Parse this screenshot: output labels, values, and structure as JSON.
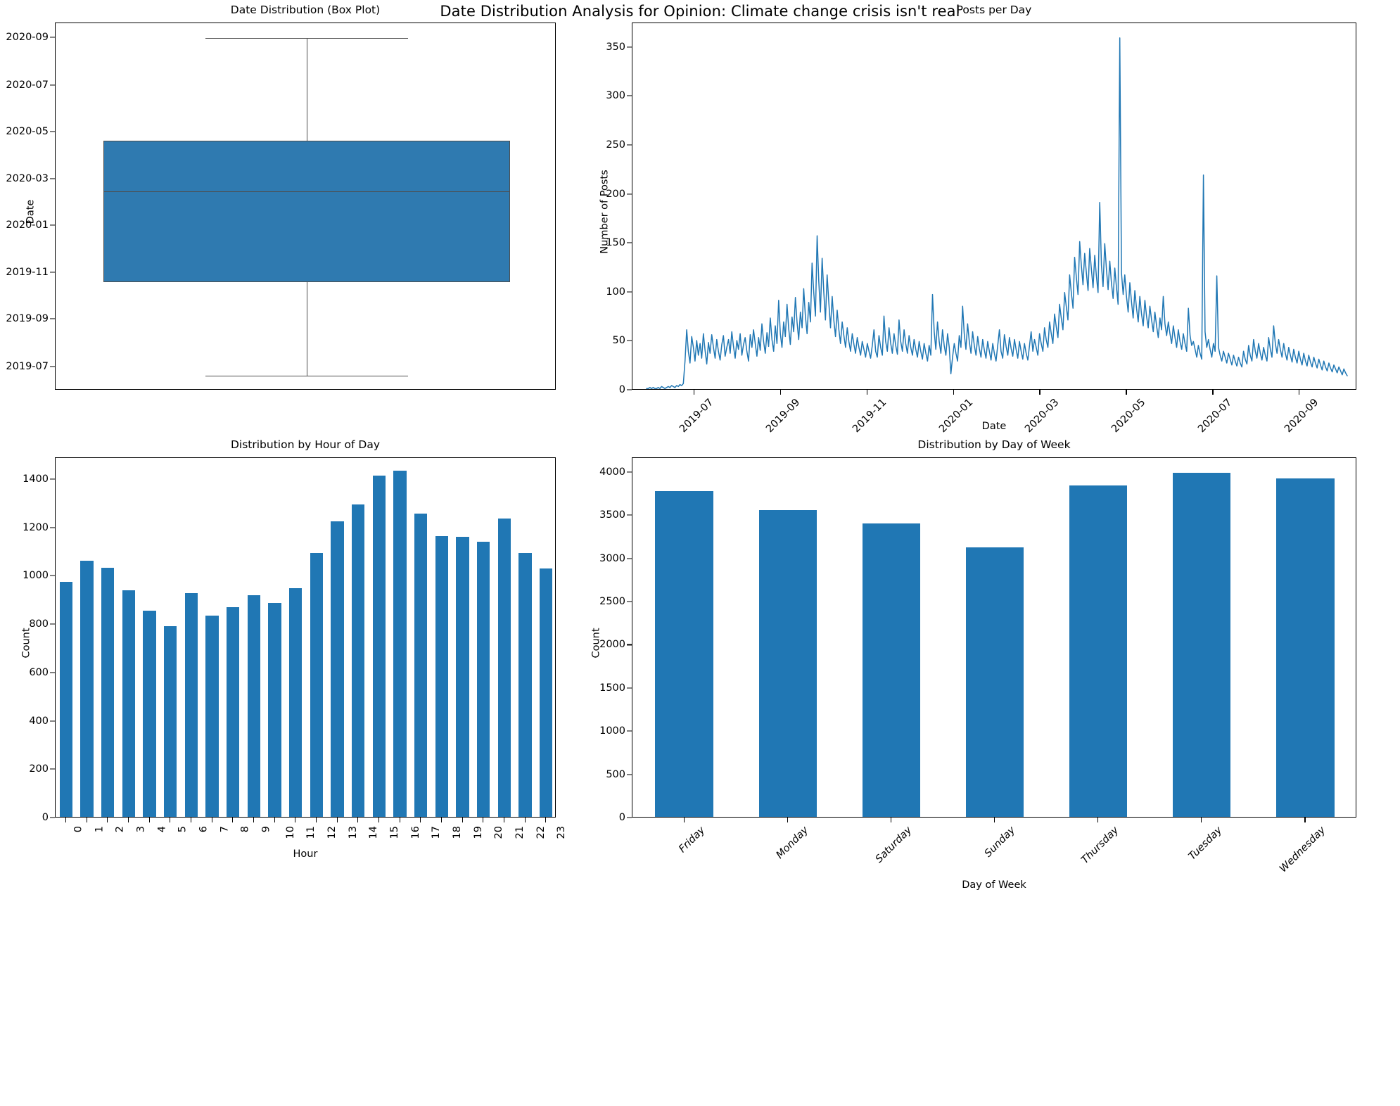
{
  "figure": {
    "title": "Date Distribution Analysis for Opinion: Climate change crisis isn't real",
    "accent_color": "#2077b4",
    "box_fill_color": "#2f7ab0",
    "line_color": "#4d4d4d"
  },
  "chart_data": [
    {
      "type": "box",
      "title": "Date Distribution (Box Plot)",
      "xlabel": "",
      "ylabel": "Date",
      "ytick_labels": [
        "2020-09",
        "2020-07",
        "2020-05",
        "2020-03",
        "2020-01",
        "2019-11",
        "2019-09",
        "2019-07"
      ],
      "ylim": [
        "2019-06-01",
        "2020-09-20"
      ],
      "grid": false,
      "box": {
        "whisker_high": "2020-09-01",
        "q3": "2020-04-20",
        "median": "2020-02-15",
        "q1": "2019-10-20",
        "whisker_low": "2019-06-20"
      }
    },
    {
      "type": "line",
      "title": "Posts per Day",
      "xlabel": "Date",
      "ylabel": "Number of Posts",
      "xtick_labels": [
        "2019-07",
        "2019-09",
        "2019-11",
        "2020-01",
        "2020-03",
        "2020-05",
        "2020-07",
        "2020-09"
      ],
      "ytick_labels": [
        "0",
        "50",
        "100",
        "150",
        "200",
        "250",
        "300",
        "350"
      ],
      "ylim": [
        0,
        375
      ],
      "grid": false,
      "peak_value": 360,
      "peak_date": "2020-04-20",
      "secondary_peak_value": 220,
      "secondary_peak_date": "2020-06-01",
      "values": [
        2,
        2,
        3,
        2,
        3,
        2,
        2,
        3,
        2,
        4,
        3,
        2,
        3,
        4,
        3,
        5,
        4,
        3,
        5,
        4,
        6,
        5,
        7,
        30,
        62,
        40,
        28,
        55,
        44,
        30,
        51,
        36,
        48,
        33,
        58,
        41,
        27,
        49,
        38,
        57,
        44,
        33,
        52,
        40,
        31,
        47,
        56,
        35,
        44,
        52,
        38,
        60,
        45,
        33,
        51,
        42,
        58,
        36,
        47,
        54,
        40,
        30,
        57,
        44,
        62,
        48,
        35,
        54,
        41,
        68,
        50,
        38,
        59,
        45,
        74,
        52,
        40,
        66,
        48,
        92,
        58,
        44,
        70,
        55,
        88,
        63,
        47,
        75,
        60,
        95,
        70,
        52,
        80,
        64,
        104,
        76,
        58,
        90,
        70,
        130,
        100,
        76,
        158,
        112,
        80,
        135,
        100,
        72,
        118,
        90,
        64,
        96,
        72,
        55,
        82,
        62,
        48,
        70,
        56,
        44,
        64,
        50,
        40,
        58,
        47,
        38,
        54,
        44,
        36,
        50,
        42,
        34,
        48,
        40,
        33,
        46,
        62,
        40,
        34,
        56,
        44,
        36,
        76,
        50,
        40,
        64,
        48,
        38,
        58,
        46,
        37,
        72,
        50,
        40,
        62,
        48,
        38,
        56,
        44,
        36,
        52,
        42,
        34,
        50,
        40,
        32,
        48,
        38,
        30,
        46,
        36,
        98,
        60,
        42,
        70,
        50,
        38,
        62,
        46,
        36,
        58,
        44,
        17,
        34,
        48,
        38,
        30,
        56,
        44,
        86,
        58,
        42,
        68,
        50,
        38,
        60,
        46,
        36,
        55,
        43,
        34,
        52,
        41,
        33,
        50,
        40,
        31,
        48,
        38,
        30,
        46,
        62,
        40,
        33,
        57,
        45,
        36,
        54,
        43,
        35,
        52,
        42,
        33,
        50,
        40,
        32,
        48,
        38,
        31,
        46,
        60,
        40,
        52,
        44,
        36,
        58,
        48,
        40,
        64,
        52,
        44,
        70,
        58,
        48,
        78,
        65,
        54,
        88,
        74,
        62,
        100,
        86,
        72,
        118,
        100,
        84,
        136,
        116,
        98,
        152,
        128,
        108,
        140,
        120,
        102,
        145,
        124,
        105,
        138,
        117,
        100,
        192,
        128,
        106,
        150,
        124,
        103,
        132,
        110,
        94,
        125,
        105,
        88,
        360,
        120,
        98,
        118,
        96,
        80,
        110,
        90,
        74,
        102,
        84,
        70,
        96,
        78,
        66,
        92,
        76,
        64,
        86,
        72,
        60,
        80,
        66,
        54,
        74,
        62,
        96,
        68,
        56,
        70,
        58,
        48,
        66,
        54,
        44,
        62,
        50,
        42,
        58,
        48,
        40,
        84,
        56,
        46,
        50,
        42,
        34,
        46,
        38,
        32,
        220,
        60,
        44,
        52,
        42,
        34,
        48,
        40,
        117,
        44,
        36,
        30,
        40,
        34,
        28,
        38,
        32,
        26,
        36,
        30,
        25,
        34,
        28,
        24,
        40,
        32,
        27,
        46,
        36,
        30,
        52,
        40,
        33,
        48,
        38,
        31,
        44,
        36,
        30,
        54,
        42,
        34,
        66,
        48,
        38,
        52,
        42,
        34,
        48,
        38,
        31,
        44,
        36,
        29,
        42,
        34,
        28,
        40,
        32,
        26,
        38,
        30,
        25,
        36,
        29,
        24,
        34,
        28,
        23,
        32,
        26,
        21,
        30,
        24,
        20,
        28,
        23,
        19,
        26,
        22,
        18,
        24,
        20,
        16,
        22,
        18,
        15
      ]
    },
    {
      "type": "bar",
      "title": "Distribution by Hour of Day",
      "xlabel": "Hour",
      "ylabel": "Count",
      "categories": [
        "0",
        "1",
        "2",
        "3",
        "4",
        "5",
        "6",
        "7",
        "8",
        "9",
        "10",
        "11",
        "12",
        "13",
        "14",
        "15",
        "16",
        "17",
        "18",
        "19",
        "20",
        "21",
        "22",
        "23"
      ],
      "values": [
        973,
        1058,
        1031,
        938,
        852,
        790,
        925,
        833,
        868,
        918,
        886,
        945,
        1090,
        1222,
        1293,
        1412,
        1433,
        1253,
        1160,
        1157,
        1139,
        1234,
        1090,
        1027
      ],
      "ytick_labels": [
        "0",
        "200",
        "400",
        "600",
        "800",
        "1000",
        "1200",
        "1400"
      ],
      "ylim": [
        0,
        1490
      ],
      "grid": false
    },
    {
      "type": "bar",
      "title": "Distribution by Day of Week",
      "xlabel": "Day of Week",
      "ylabel": "Count",
      "categories": [
        "Friday",
        "Monday",
        "Saturday",
        "Sunday",
        "Thursday",
        "Tuesday",
        "Wednesday"
      ],
      "values": [
        3770,
        3552,
        3396,
        3123,
        3833,
        3983,
        3920
      ],
      "ytick_labels": [
        "0",
        "500",
        "1000",
        "1500",
        "2000",
        "2500",
        "3000",
        "3500",
        "4000"
      ],
      "ylim": [
        0,
        4170
      ],
      "grid": false
    }
  ]
}
